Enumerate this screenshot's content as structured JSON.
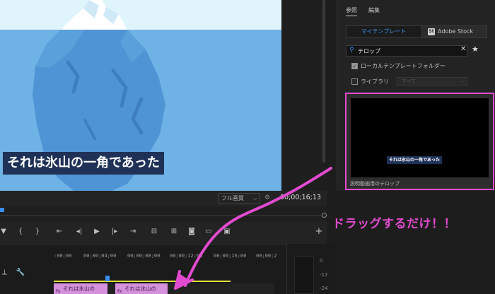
{
  "monitor": {
    "caption_text": "それは氷山の一角であった",
    "quality_label": "フル画質",
    "timecode": "00;00;16;13"
  },
  "transport": {
    "mark_in": "▼",
    "mark_in_bracket": "{",
    "mark_out_bracket": "}",
    "go_to_in": "⇤",
    "step_back": "◂|",
    "play": "▶",
    "step_forward": "|▸",
    "go_to_out": "⇥",
    "lift": "⊟",
    "extract": "⊞",
    "export_frame": "◙",
    "add": "+"
  },
  "timeline": {
    "tick_labels": [
      ":00;00",
      "00;00;04;00",
      "00;00;08;00",
      "00;00;12;00",
      "00;00;16;00",
      "00;00;2"
    ],
    "clips": [
      {
        "label": "それは氷山の",
        "fx": "fx"
      },
      {
        "label": "それは氷山の",
        "fx": "fx"
      }
    ],
    "meter_labels": [
      "0",
      "-12",
      "-24"
    ]
  },
  "panel": {
    "tab_browse": "参照",
    "tab_edit": "編集",
    "segment_mine": "マイテンプレート",
    "segment_stock": "Adobe Stock",
    "stock_icon": "St",
    "search_value": "テロップ",
    "search_placeholder": "",
    "local_folder_label": "ローカルテンプレートフォルダー",
    "library_label": "ライブラリ",
    "library_select_value": "すべて",
    "template_thumb_caption": "それは氷山の一角であった",
    "template_name": "説明動画用のテロップ"
  },
  "annotation": {
    "drag_text": "ドラッグするだけ！！",
    "color": "#e24bd0"
  },
  "colors": {
    "sky": "#dff4fb",
    "water": "#6fb2e6",
    "iceberg": "#4f94d4",
    "caption_bg": "#1f3157",
    "accent_blue": "#3d8eea",
    "clip_pink": "#d691dc",
    "work_area_yellow": "#e3e03a"
  }
}
